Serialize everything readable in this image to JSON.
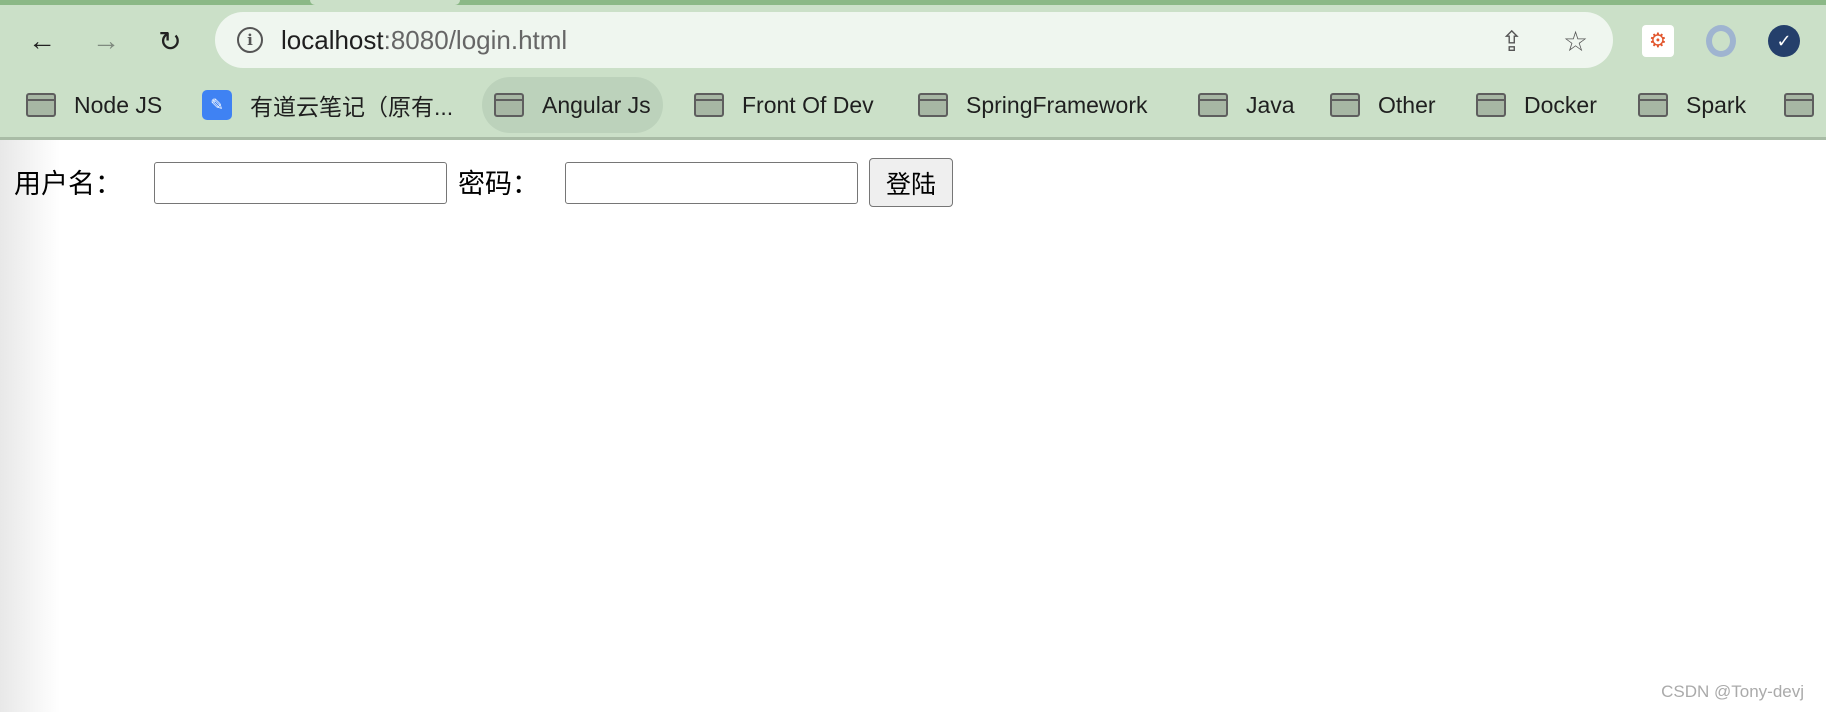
{
  "browser": {
    "url_host": "localhost",
    "url_rest": ":8080/login.html",
    "nav": {
      "back_icon": "arrow-left",
      "forward_icon": "arrow-right",
      "reload_icon": "reload"
    },
    "bookmarks": [
      {
        "label": "Node JS",
        "icon": "folder"
      },
      {
        "label": "有道云笔记（原有...",
        "icon": "youdao-note"
      },
      {
        "label": "Angular Js",
        "icon": "folder"
      },
      {
        "label": "Front Of Dev",
        "icon": "folder"
      },
      {
        "label": "SpringFramework",
        "icon": "folder"
      },
      {
        "label": "Java",
        "icon": "folder"
      },
      {
        "label": "Other",
        "icon": "folder"
      },
      {
        "label": "Docker",
        "icon": "folder"
      },
      {
        "label": "Spark",
        "icon": "folder"
      }
    ]
  },
  "form": {
    "username_label": "用户名：",
    "username_value": "",
    "password_label": "密码：",
    "password_value": "",
    "submit_label": "登陆"
  },
  "watermark": "CSDN @Tony-devj"
}
